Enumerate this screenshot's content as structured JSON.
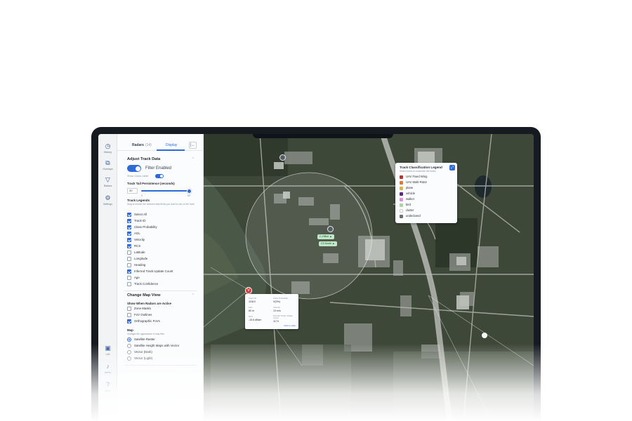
{
  "nav": {
    "items": [
      {
        "name": "history",
        "label": "History",
        "icon": "clock-icon"
      },
      {
        "name": "overlays",
        "label": "Overlays",
        "icon": "layers-icon"
      },
      {
        "name": "radars",
        "label": "Radars",
        "icon": "radar-icon"
      },
      {
        "name": "settings",
        "label": "Settings",
        "icon": "gear-icon"
      }
    ],
    "bottom": [
      {
        "name": "lab",
        "label": "Lab",
        "icon": "flask-icon"
      },
      {
        "name": "alerts",
        "label": "Alerts",
        "icon": "bell-icon"
      },
      {
        "name": "help",
        "label": "Help",
        "icon": "help-icon"
      }
    ]
  },
  "panel": {
    "tab_radars": "Radars",
    "tab_radars_count": "(14)",
    "tab_display": "Display",
    "collapse_label": "|←",
    "adjust": {
      "title": "Adjust Track Data",
      "filter_label": "Filter Enabled",
      "show_class_label": "Show Class Label",
      "tail_label": "Track Tail Persistence (seconds)",
      "tail_value": "40",
      "tail_min": "0",
      "tail_max": "60",
      "legend_title": "Track Legends",
      "legend_help": "Drag to reorder the selected data fields you want to see on the track",
      "fields": [
        {
          "label": "Select All",
          "checked": true
        },
        {
          "label": "Track ID",
          "checked": true
        },
        {
          "label": "Class Probability",
          "checked": true
        },
        {
          "label": "AGL",
          "checked": true
        },
        {
          "label": "Velocity",
          "checked": true
        },
        {
          "label": "RCS",
          "checked": true
        },
        {
          "label": "Latitude",
          "checked": false
        },
        {
          "label": "Longitude",
          "checked": false
        },
        {
          "label": "Heading",
          "checked": false
        },
        {
          "label": "Inferred Track Update Count",
          "checked": true
        },
        {
          "label": "Age",
          "checked": false
        },
        {
          "label": "Track Confidence",
          "checked": false
        }
      ]
    },
    "mapview": {
      "title": "Change Map View",
      "show_when_label": "Show When Radars are Active",
      "overlays": [
        {
          "label": "Zone Masks",
          "checked": false
        },
        {
          "label": "FoV Outlines",
          "checked": false
        },
        {
          "label": "Orthographic FoVs",
          "checked": true
        }
      ],
      "map_label": "Map",
      "map_help": "Changes the appearance of map tiles",
      "map_options": [
        {
          "label": "Satellite Raster",
          "selected": true
        },
        {
          "label": "Satellite Height Maps with Vector",
          "selected": false
        },
        {
          "label": "Vector (Dark)",
          "selected": false
        },
        {
          "label": "Vector (Light)",
          "selected": false
        }
      ]
    }
  },
  "legend": {
    "title": "Track Classification Legend",
    "subtitle": "Select colors to customize the tracks",
    "close_icon": "expand-icon",
    "items": [
      {
        "label": "UAV Fixed Wing",
        "color": "#c4302b"
      },
      {
        "label": "UAV Multi-Rotor",
        "color": "#e07a2f"
      },
      {
        "label": "plane",
        "color": "#e3b43a"
      },
      {
        "label": "vehicle",
        "color": "#5b2a86"
      },
      {
        "label": "walker",
        "color": "#e58be0"
      },
      {
        "label": "bird",
        "color": "#a8d8a0"
      },
      {
        "label": "clutter",
        "color": "#ffffff"
      },
      {
        "label": "undeclared",
        "color": "#707070"
      }
    ]
  },
  "track_popup": {
    "fields": [
      {
        "label": "Track ID",
        "value": "11610"
      },
      {
        "label": "Class Probability",
        "value": "V(0%)"
      },
      {
        "label": "AGL",
        "value": "60 m"
      },
      {
        "label": "Velocity",
        "value": "13 m/s"
      },
      {
        "label": "RCS",
        "value": "-15.6 dBsm"
      },
      {
        "label": "Inferred Track Update Count",
        "value": "1174"
      }
    ],
    "link": "Click to Hide"
  },
  "map_labels": [
    {
      "text": "C-Office ▲"
    },
    {
      "text": "C3 South ▲"
    }
  ],
  "marker_red_label": "V"
}
